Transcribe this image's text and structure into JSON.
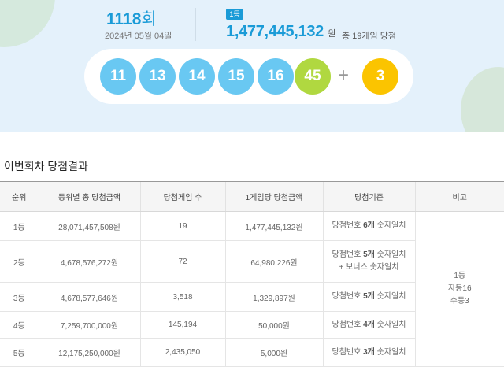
{
  "draw": {
    "round_number": "1118",
    "round_suffix": "회",
    "date": "2024년 05월 04일",
    "rank_badge": "1등",
    "first_prize_amount": "1,477,445,132",
    "first_prize_unit": "원",
    "winners_text": "총 19게임 당첨",
    "numbers": [
      "11",
      "13",
      "14",
      "15",
      "16",
      "45"
    ],
    "plus": "+",
    "bonus": "3",
    "ball_colors": {
      "blue": "#69c8f2",
      "green": "#b0d840",
      "yellow": "#fbc400"
    }
  },
  "results": {
    "title": "이번회차 당첨결과",
    "headers": [
      "순위",
      "등위별 총 당첨금액",
      "당첨게임 수",
      "1게임당 당첨금액",
      "당첨기준",
      "비고"
    ],
    "rows": [
      {
        "rank": "1등",
        "total": "28,071,457,508원",
        "games": "19",
        "per_game": "1,477,445,132원",
        "crit_pre": "당첨번호 ",
        "crit_bold": "6개",
        "crit_post": " 숫자일치",
        "crit_line2": ""
      },
      {
        "rank": "2등",
        "total": "4,678,576,272원",
        "games": "72",
        "per_game": "64,980,226원",
        "crit_pre": "당첨번호 ",
        "crit_bold": "5개",
        "crit_post": " 숫자일치",
        "crit_line2": "+ 보너스 숫자일치"
      },
      {
        "rank": "3등",
        "total": "4,678,577,646원",
        "games": "3,518",
        "per_game": "1,329,897원",
        "crit_pre": "당첨번호 ",
        "crit_bold": "5개",
        "crit_post": " 숫자일치",
        "crit_line2": ""
      },
      {
        "rank": "4등",
        "total": "7,259,700,000원",
        "games": "145,194",
        "per_game": "50,000원",
        "crit_pre": "당첨번호 ",
        "crit_bold": "4개",
        "crit_post": " 숫자일치",
        "crit_line2": ""
      },
      {
        "rank": "5등",
        "total": "12,175,250,000원",
        "games": "2,435,050",
        "per_game": "5,000원",
        "crit_pre": "당첨번호 ",
        "crit_bold": "3개",
        "crit_post": " 숫자일치",
        "crit_line2": ""
      }
    ],
    "note_lines": [
      "1등",
      "자동16",
      "수동3"
    ]
  }
}
